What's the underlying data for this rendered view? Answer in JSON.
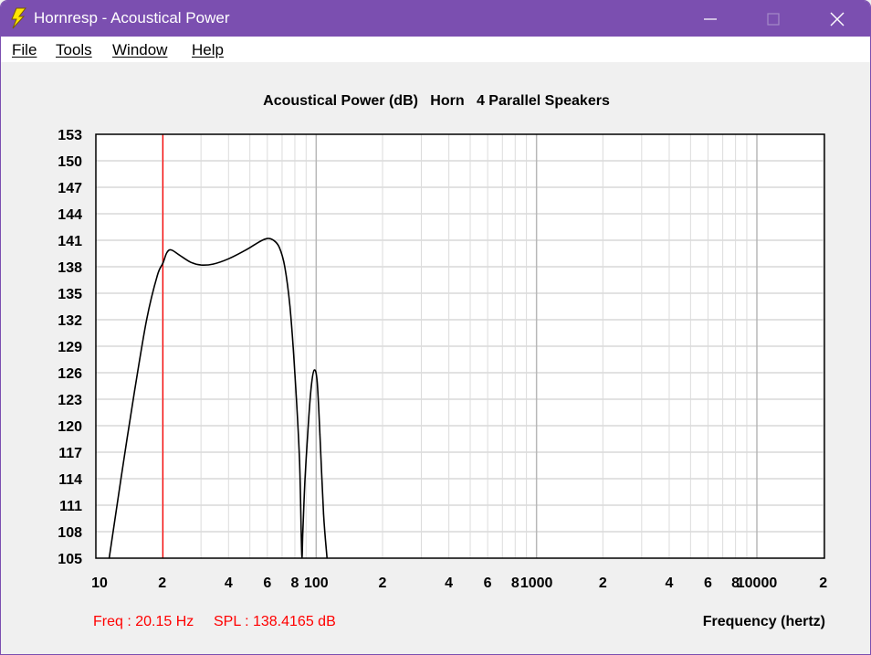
{
  "window": {
    "title": "Hornresp - Acoustical Power",
    "accent": "#7b4fb0",
    "controls": [
      "minimize-icon",
      "maximize-icon",
      "close-icon"
    ]
  },
  "menu": {
    "file": "File",
    "tools": "Tools",
    "window": "Window",
    "help": "Help"
  },
  "status": {
    "freq": "Freq : 20.15 Hz",
    "spl": "SPL : 138.4165 dB",
    "color": "#ff0000"
  },
  "chart_data": {
    "type": "line",
    "title": "Acoustical Power (dB)   Horn   4 Parallel Speakers",
    "xlabel": "Frequency (hertz)",
    "ylabel": "",
    "x_scale": "log",
    "xlim": [
      10,
      20000
    ],
    "ylim": [
      105,
      153
    ],
    "y_ticks": [
      "153",
      "150",
      "147",
      "144",
      "141",
      "138",
      "135",
      "132",
      "129",
      "126",
      "123",
      "120",
      "117",
      "114",
      "111",
      "108",
      "105"
    ],
    "x_tick_labels": [
      {
        "value": 10,
        "label": "10"
      },
      {
        "value": 20,
        "label": "2"
      },
      {
        "value": 40,
        "label": "4"
      },
      {
        "value": 60,
        "label": "6"
      },
      {
        "value": 80,
        "label": "8"
      },
      {
        "value": 100,
        "label": "100"
      },
      {
        "value": 200,
        "label": "2"
      },
      {
        "value": 400,
        "label": "4"
      },
      {
        "value": 600,
        "label": "6"
      },
      {
        "value": 800,
        "label": "8"
      },
      {
        "value": 1000,
        "label": "1000"
      },
      {
        "value": 2000,
        "label": "2"
      },
      {
        "value": 4000,
        "label": "4"
      },
      {
        "value": 6000,
        "label": "6"
      },
      {
        "value": 8000,
        "label": "8"
      },
      {
        "value": 10000,
        "label": "10000"
      },
      {
        "value": 20000,
        "label": "2"
      }
    ],
    "grid": true,
    "series": [
      {
        "color": "#000000",
        "points": [
          [
            11.5,
            105.0
          ],
          [
            13.0,
            114.0
          ],
          [
            15.0,
            124.0
          ],
          [
            17.0,
            132.0
          ],
          [
            19.0,
            137.0
          ],
          [
            20.15,
            138.4
          ],
          [
            21.0,
            139.6
          ],
          [
            22.0,
            139.9
          ],
          [
            24.0,
            139.3
          ],
          [
            27.0,
            138.5
          ],
          [
            30.0,
            138.2
          ],
          [
            34.0,
            138.3
          ],
          [
            40.0,
            138.9
          ],
          [
            48.0,
            139.9
          ],
          [
            55.0,
            140.8
          ],
          [
            60.0,
            141.2
          ],
          [
            64.0,
            141.0
          ],
          [
            68.0,
            140.2
          ],
          [
            72.0,
            138.0
          ],
          [
            76.0,
            133.5
          ],
          [
            80.0,
            126.0
          ],
          [
            84.0,
            116.0
          ],
          [
            86.0,
            105.5
          ],
          [
            87.0,
            108.0
          ],
          [
            89.0,
            114.0
          ],
          [
            92.0,
            120.0
          ],
          [
            95.0,
            124.5
          ],
          [
            98.0,
            126.3
          ],
          [
            101.0,
            125.0
          ],
          [
            104.0,
            119.0
          ],
          [
            108.0,
            110.0
          ],
          [
            112.0,
            105.0
          ]
        ]
      }
    ],
    "marker": {
      "x": 20.15,
      "color": "#ff0000"
    }
  }
}
